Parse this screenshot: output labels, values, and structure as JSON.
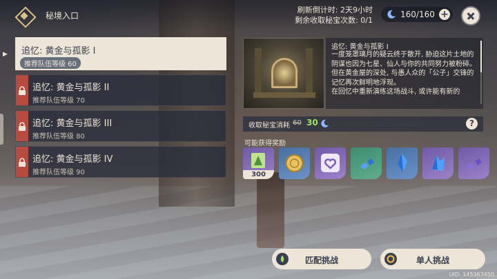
{
  "header": {
    "title": "秘境入口",
    "refresh_countdown": "刷新倒计时: 2天9小时",
    "claims_left": "剩余收取秘宝次数: 0/1",
    "resin": "160/160",
    "plus_label": "+"
  },
  "domains": [
    {
      "name": "追忆: 黄金与孤影 I",
      "level": "推荐队伍等级 60",
      "locked": false,
      "active": true
    },
    {
      "name": "追忆: 黄金与孤影 II",
      "level": "推荐队伍等级 70",
      "locked": true,
      "active": false
    },
    {
      "name": "追忆: 黄金与孤影 III",
      "level": "推荐队伍等级 80",
      "locked": true,
      "active": false
    },
    {
      "name": "追忆: 黄金与孤影 IV",
      "level": "推荐队伍等级 90",
      "locked": true,
      "active": false
    }
  ],
  "detail": {
    "title": "追忆: 黄金与孤影 I",
    "paragraphs": [
      "一度笼罩璃月的疑云终于散开, 胁迫这片土地的阴谋也因为七星、仙人与你的共同努力被粉碎。",
      "但在黄金屋的深处, 与愚人众的「公子」交锋的记忆再次鲜明地浮现。",
      "在回忆中重新演练这场战斗, 或许能有新的"
    ]
  },
  "cost": {
    "label": "收取秘宝消耗",
    "old": "60",
    "new": "30",
    "help": "?"
  },
  "rewards": {
    "label": "可能获得奖励",
    "items": [
      {
        "icon": "adventure-exp-icon",
        "rarity": "purple",
        "count": "300"
      },
      {
        "icon": "mora-coin-icon",
        "rarity": "blue",
        "count": ""
      },
      {
        "icon": "companionship-exp-icon",
        "rarity": "purple",
        "count": ""
      },
      {
        "icon": "material-green-icon",
        "rarity": "green",
        "count": ""
      },
      {
        "icon": "material-blue-icon",
        "rarity": "blue",
        "count": ""
      },
      {
        "icon": "material-purple-icon",
        "rarity": "purple",
        "count": ""
      },
      {
        "icon": "material-purple-icon",
        "rarity": "purple",
        "count": ""
      }
    ]
  },
  "buttons": {
    "match": "匹配挑战",
    "solo": "单人挑战"
  },
  "uid": "UID: 145363450",
  "colors": {
    "panel_text": "#ece5d8",
    "dark_text": "#3b3f4d",
    "lock_red": "#b84b3f",
    "cost_green": "#9be26b"
  }
}
